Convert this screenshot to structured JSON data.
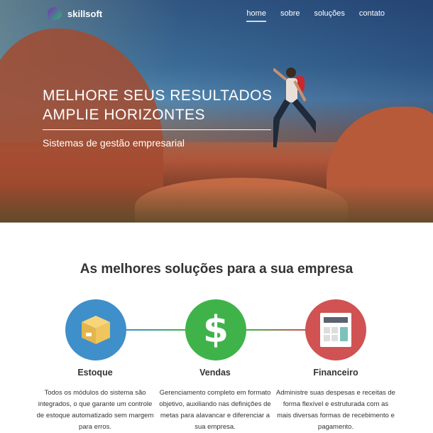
{
  "header": {
    "brand": "skillsoft",
    "nav": [
      {
        "label": "home",
        "active": true
      },
      {
        "label": "sobre"
      },
      {
        "label": "soluções"
      },
      {
        "label": "contato"
      }
    ]
  },
  "hero": {
    "title_line1": "MELHORE SEUS RESULTADOS",
    "title_line2": "AMPLIE HORIZONTES",
    "subtitle": "Sistemas de gestão empresarial"
  },
  "solutions": {
    "title": "As melhores soluções para a sua empresa",
    "items": [
      {
        "name": "Estoque",
        "icon": "box-icon",
        "color": "#3f8fca",
        "text": "Todos os módulos do sistema são integrados, o que garante um controle de estoque automatizado sem margem para erros."
      },
      {
        "name": "Vendas",
        "icon": "dollar-icon",
        "color": "#3fb34a",
        "text": "Gerenciamento completo em formato objetivo, auxiliando nas definições de metas para alavancar e diferenciar a sua empresa."
      },
      {
        "name": "Financeiro",
        "icon": "calculator-icon",
        "color": "#d05252",
        "text": "Administre suas despesas e receitas de forma flexível e estruturada com as mais diversas formas de recebimento e pagamento."
      }
    ]
  }
}
